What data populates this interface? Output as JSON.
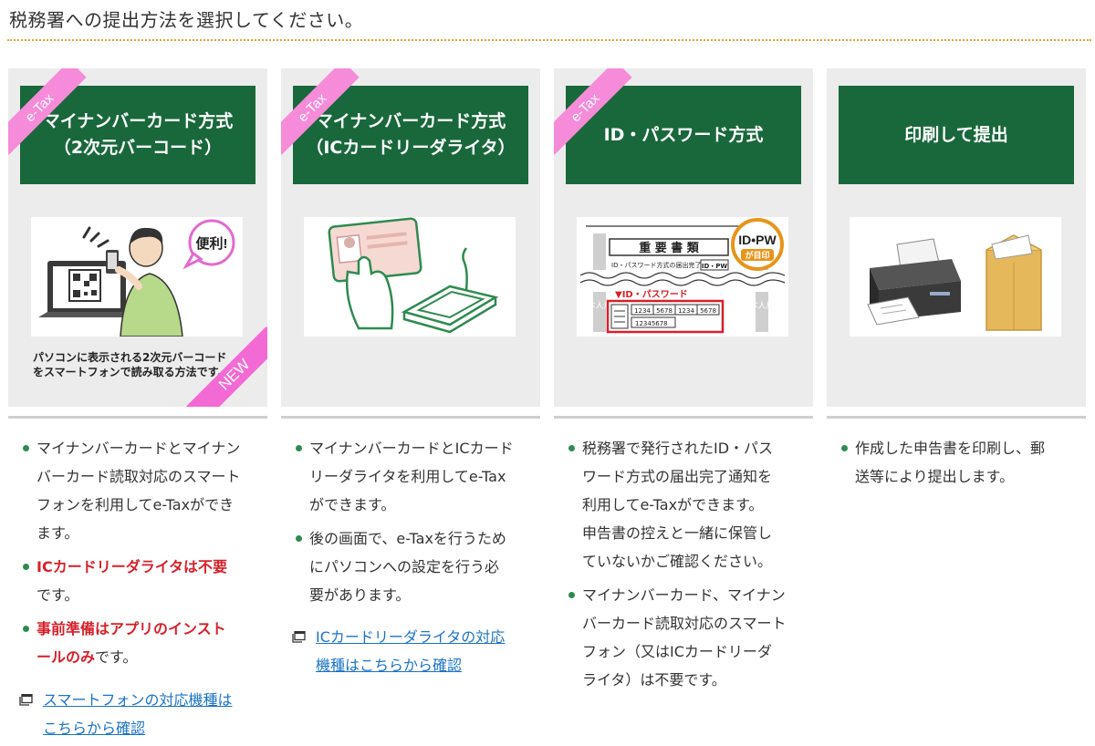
{
  "page": {
    "title": "税務署への提出方法を選択してください。"
  },
  "badges": {
    "etax": "e-Tax",
    "new": "NEW"
  },
  "cards": [
    {
      "title_lines": [
        "マイナンバーカード方式",
        "（2次元バーコード）"
      ],
      "illustration": {
        "speech": "便利!"
      },
      "caption_lines": [
        "パソコンに表示される2次元バーコード",
        "をスマートフォンで読み取る方法です。"
      ],
      "bullets": [
        {
          "parts": [
            "マイナンバーカードとマイナン",
            "バーカード読取対応のスマート",
            "フォンを利用してe-Taxができ",
            "ます。"
          ]
        },
        {
          "red": "ICカードリーダライタは不要",
          "rest": "です。"
        },
        {
          "red_lines": [
            "事前準備はアプリのインスト",
            "ールのみ"
          ],
          "rest": "です。"
        }
      ],
      "link_lines": [
        "スマートフォンの対応機種は",
        "こちらから確認"
      ]
    },
    {
      "title_lines": [
        "マイナンバーカード方式",
        "（ICカードリーダライタ）"
      ],
      "bullets": [
        {
          "parts": [
            "マイナンバーカードとICカード",
            "リーダライタを利用してe-Tax",
            "ができます。"
          ]
        },
        {
          "parts": [
            "後の画面で、e-Taxを行うため",
            "にパソコンへの設定を行う必",
            "要があります。"
          ]
        }
      ],
      "link_lines": [
        "ICカードリーダライタの対応",
        "機種はこちらから確認"
      ]
    },
    {
      "title_lines": [
        "ID・パスワード方式"
      ],
      "illustration": {
        "doc_title": "重 要 書 類",
        "doc_subtitle": "ID・パスワード方式の届出完了通知",
        "doc_small_badge": "ID・PW",
        "badge_line1": "ID•PW",
        "badge_line2": "が目印",
        "section_label": "▼ID・パスワード",
        "id_values": [
          "1234",
          "5678",
          "1234",
          "5678"
        ],
        "pw_value": "12345678",
        "side_label": "本人用"
      },
      "bullets": [
        {
          "parts": [
            "税務署で発行されたID・パス",
            "ワード方式の届出完了通知を",
            "利用してe-Taxができます。",
            "申告書の控えと一緒に保管し",
            "ていないかご確認ください。"
          ]
        },
        {
          "parts": [
            "マイナンバーカード、マイナン",
            "バーカード読取対応のスマート",
            "フォン（又はICカードリーダ",
            "ライタ）は不要です。"
          ]
        }
      ]
    },
    {
      "title_lines": [
        "印刷して提出"
      ],
      "bullets": [
        {
          "parts": [
            "作成した申告書を印刷し、郵",
            "送等により提出します。"
          ]
        }
      ]
    }
  ],
  "colors": {
    "green": "#19683b",
    "pink": "#f68bd9",
    "red": "#d8202a",
    "link": "#1a73c8",
    "rule_gold": "#d9a437"
  }
}
